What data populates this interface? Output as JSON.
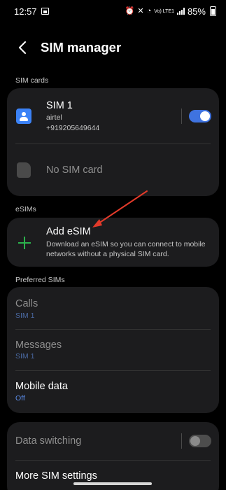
{
  "status_bar": {
    "time": "12:57",
    "battery": "85%",
    "network_type": "Vo) LTE1",
    "icons": [
      "image-icon",
      "alarm-icon",
      "mute-icon",
      "wifi-icon",
      "signal-icon",
      "battery-icon"
    ]
  },
  "header": {
    "title": "SIM manager",
    "back_icon": "chevron-left-icon"
  },
  "sim_cards": {
    "label": "SIM cards",
    "sim1": {
      "name": "SIM 1",
      "carrier": "airtel",
      "number": "+919205649644",
      "enabled": true
    },
    "sim2": {
      "name": "No SIM card"
    }
  },
  "esims": {
    "label": "eSIMs",
    "add": {
      "title": "Add eSIM",
      "description": "Download an eSIM so you can connect to mobile networks without a physical SIM card."
    }
  },
  "preferred": {
    "label": "Preferred SIMs",
    "calls": {
      "title": "Calls",
      "value": "SIM 1"
    },
    "messages": {
      "title": "Messages",
      "value": "SIM 1"
    },
    "mobile_data": {
      "title": "Mobile data",
      "value": "Off"
    }
  },
  "more": {
    "data_switching": {
      "title": "Data switching",
      "enabled": false
    },
    "more_settings": {
      "title": "More SIM settings"
    }
  },
  "colors": {
    "accent": "#3f73e0",
    "card": "#1c1c1e",
    "plus": "#2bb24c",
    "annotation_arrow": "#e23a2a"
  }
}
